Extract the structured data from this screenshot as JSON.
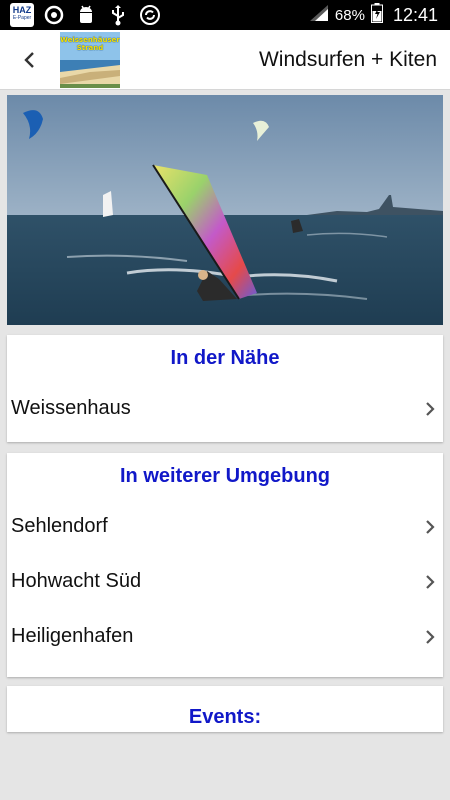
{
  "status_bar": {
    "app_badge": "HAZ",
    "app_badge_sub": "E-Paper",
    "battery": "68%",
    "time": "12:41",
    "icons": [
      "haz-app-icon",
      "sync-icon",
      "android-icon",
      "usb-icon",
      "refresh-icon",
      "signal-icon",
      "battery-icon"
    ]
  },
  "app_bar": {
    "title": "Windsurfen + Kiten",
    "logo_line1": "Weissenhäuser",
    "logo_line2": "Strand"
  },
  "sections": {
    "nearby": {
      "heading": "In der Nähe",
      "items": [
        {
          "label": "Weissenhaus"
        }
      ]
    },
    "further": {
      "heading": "In weiterer Umgebung",
      "items": [
        {
          "label": "Sehlendorf"
        },
        {
          "label": "Hohwacht Süd"
        },
        {
          "label": "Heiligenhafen"
        }
      ]
    },
    "events": {
      "heading": "Events:"
    }
  },
  "colors": {
    "heading": "#1118c8",
    "background": "#e5e5e5",
    "status_bar": "#000000"
  }
}
